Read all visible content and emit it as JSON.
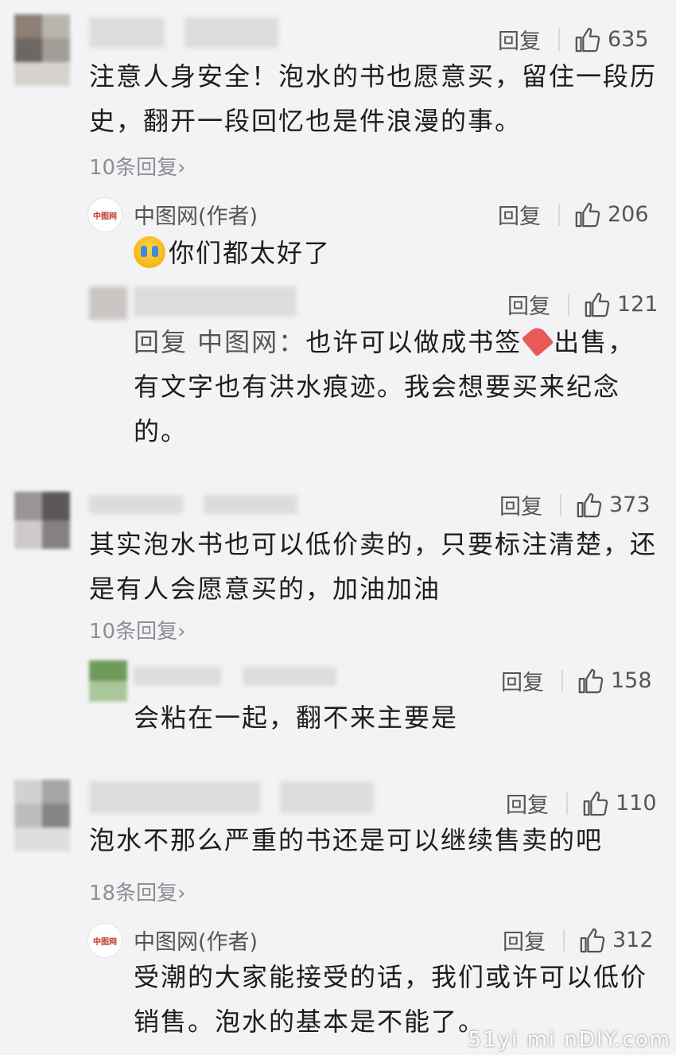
{
  "comments": [
    {
      "likes": "635",
      "text": "注意人身安全！泡水的书也愿意买，留住一段历史，翻开一段回忆也是件浪漫的事。",
      "more": "10条回复›",
      "replies": [
        {
          "author": "中图网(作者)",
          "likes": "206",
          "text": "你们都太好了"
        },
        {
          "likes": "121",
          "reply_prefix": "回复 中图网：",
          "text_a": "也许可以做成书签",
          "text_b": "出售，有文字也有洪水痕迹。我会想要买来纪念的。"
        }
      ]
    },
    {
      "likes": "373",
      "text": "其实泡水书也可以低价卖的，只要标注清楚，还是有人会愿意买的，加油加油",
      "more": "10条回复›",
      "replies": [
        {
          "likes": "158",
          "text": "会粘在一起，翻不来主要是"
        }
      ]
    },
    {
      "likes": "110",
      "text": "泡水不那么严重的书还是可以继续售卖的吧",
      "more": "18条回复›",
      "replies": [
        {
          "author": "中图网(作者)",
          "likes": "312",
          "text": "受潮的大家能接受的话，我们或许可以低价销售。泡水的基本是不能了。"
        }
      ]
    }
  ],
  "labels": {
    "reply": "回复",
    "logo": "中图网"
  },
  "icons": {
    "like": "thumbs-up-icon",
    "emoji": "crying-emoji-icon",
    "bookmark": "bookmark-tag-icon"
  },
  "watermark": "51yi mi nDIY.com"
}
